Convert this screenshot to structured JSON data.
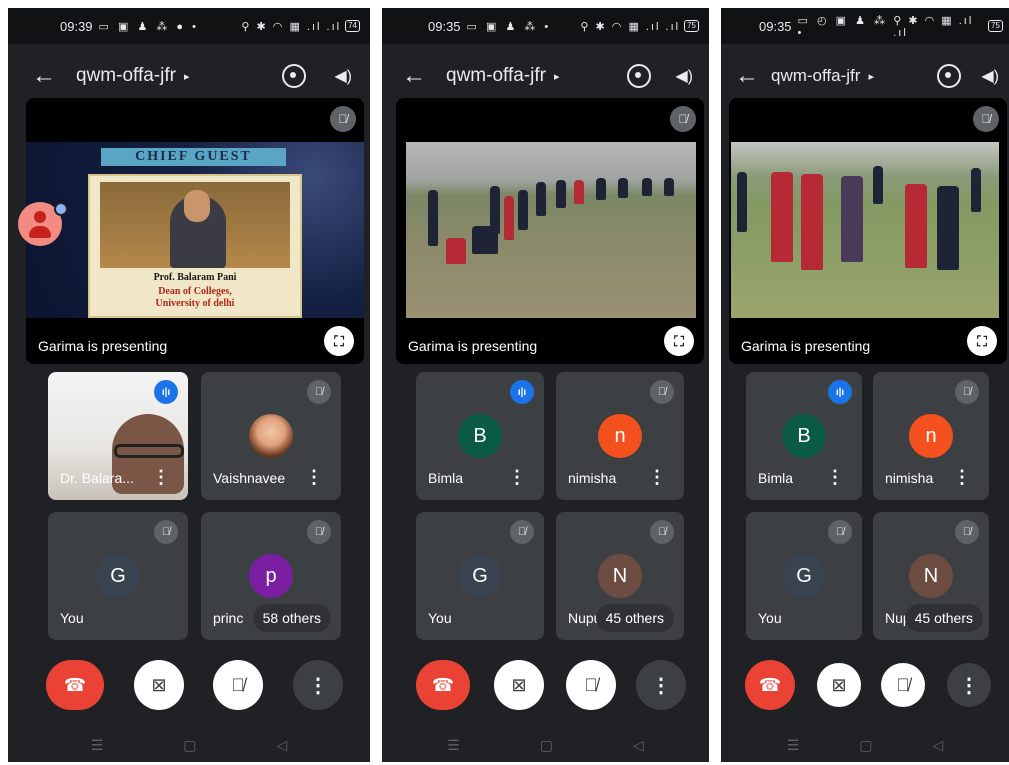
{
  "meeting_code": "qwm-offa-jfr",
  "presenting_label": "Garima is presenting",
  "icons": {
    "back": "←",
    "caret": "▸",
    "speaker": "◀)",
    "mic_off": "🎙̸",
    "speaking": "ı|ı",
    "fullscreen": "⛶",
    "more": "⋮",
    "end_call": "☎",
    "camera_off": "⊠",
    "nav_recents": "☰",
    "nav_home": "▢",
    "nav_back": "◁"
  },
  "colors": {
    "background": "#202124",
    "end_call": "#ea4335",
    "speaking": "#1a73e8"
  },
  "phones": [
    {
      "time": "09:39",
      "battery": "74",
      "slide": {
        "title": "CHIEF GUEST",
        "line1": "Prof. Balaram Pani",
        "line2": "Dean of Colleges,",
        "line3": "University of delhi"
      },
      "tiles": [
        {
          "name": "Dr. Balara...",
          "avatar": "",
          "status": "speaking"
        },
        {
          "name": "Vaishnavee",
          "avatar": "",
          "status": "muted"
        },
        {
          "name": "You",
          "avatar": "G",
          "status": "muted"
        },
        {
          "name": "princ",
          "avatar": "p",
          "status": "muted",
          "others": "58 others"
        }
      ]
    },
    {
      "time": "09:35",
      "battery": "75",
      "tiles": [
        {
          "name": "Bimla",
          "avatar": "B",
          "status": "speaking"
        },
        {
          "name": "nimisha",
          "avatar": "n",
          "status": "muted"
        },
        {
          "name": "You",
          "avatar": "G",
          "status": "muted"
        },
        {
          "name": "Nupur",
          "avatar": "N",
          "status": "muted",
          "others": "45 others"
        }
      ]
    },
    {
      "time": "09:35",
      "battery": "75",
      "tiles": [
        {
          "name": "Bimla",
          "avatar": "B",
          "status": "speaking"
        },
        {
          "name": "nimisha",
          "avatar": "n",
          "status": "muted"
        },
        {
          "name": "You",
          "avatar": "G",
          "status": "muted"
        },
        {
          "name": "Nupur",
          "avatar": "N",
          "status": "muted",
          "others": "45 others"
        }
      ]
    }
  ]
}
